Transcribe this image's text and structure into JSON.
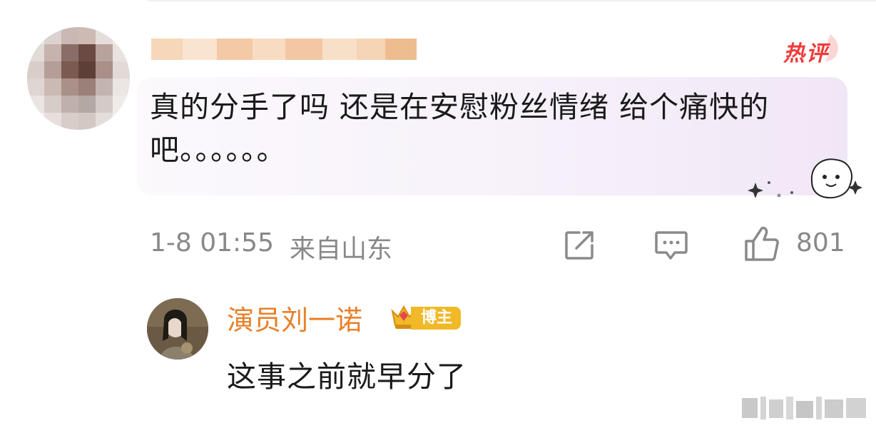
{
  "comment": {
    "hot_badge": "热评",
    "text": "真的分手了吗 还是在安慰粉丝情绪 给个痛快的吧。。。。。。",
    "time": "1-8 01:55",
    "region": "来自山东",
    "like_count": "801",
    "icons": [
      "share-icon",
      "comment-icon",
      "like-icon"
    ]
  },
  "reply": {
    "author": "演员刘一诺",
    "tag": "博主",
    "text": "这事之前就早分了"
  },
  "colors": {
    "hot_red": "#ee3b3b",
    "name_orange": "#e8802a",
    "tag_gold": "#f1b928",
    "meta_gray": "#888888"
  }
}
